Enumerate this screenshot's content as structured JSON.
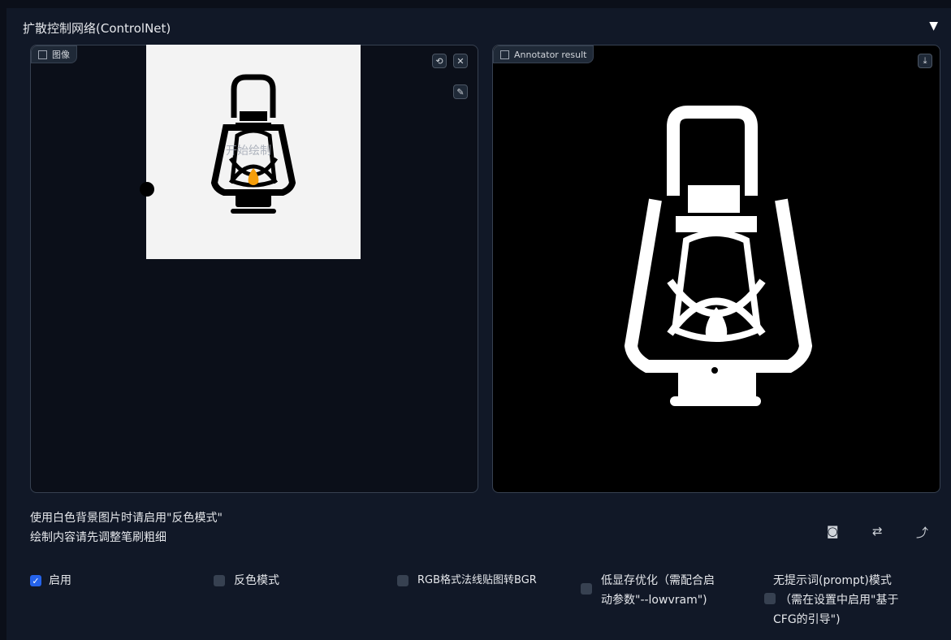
{
  "section": {
    "title": "扩散控制网络(ControlNet)",
    "collapse_glyph": "▼"
  },
  "image_panel": {
    "label": "图像",
    "icon": "image-icon",
    "watermark": "开始绘制",
    "tools": {
      "undo": "⟲",
      "clear": "✕",
      "brush": "✎"
    }
  },
  "result_panel": {
    "label": "Annotator result",
    "icon": "image-icon",
    "download_glyph": "⤓"
  },
  "hints": [
    "使用白色背景图片时请启用\"反色模式\"",
    "绘制内容请先调整笔刷粗细"
  ],
  "toolbar_icons": {
    "camera": "◙",
    "swap": "⇄",
    "send": "⤴"
  },
  "options": {
    "enable": {
      "label": "启用",
      "checked": true
    },
    "invert": {
      "label": "反色模式",
      "checked": false
    },
    "rgb_bgr": {
      "label": "RGB格式法线贴图转BGR",
      "checked": false
    },
    "lowvram": {
      "label_line1": "低显存优化（需配合启",
      "label_line2": "动参数\"--lowvram\")",
      "checked": false
    },
    "guess": {
      "label_line1": "无提示词(prompt)模式",
      "label_line2": "（需在设置中启用\"基于",
      "label_line3": "CFG的引导\")",
      "checked": false
    }
  },
  "colors": {
    "accent": "#2563eb",
    "panel": "#111827",
    "page": "#0b0f19",
    "flame": "#f59e0b"
  }
}
